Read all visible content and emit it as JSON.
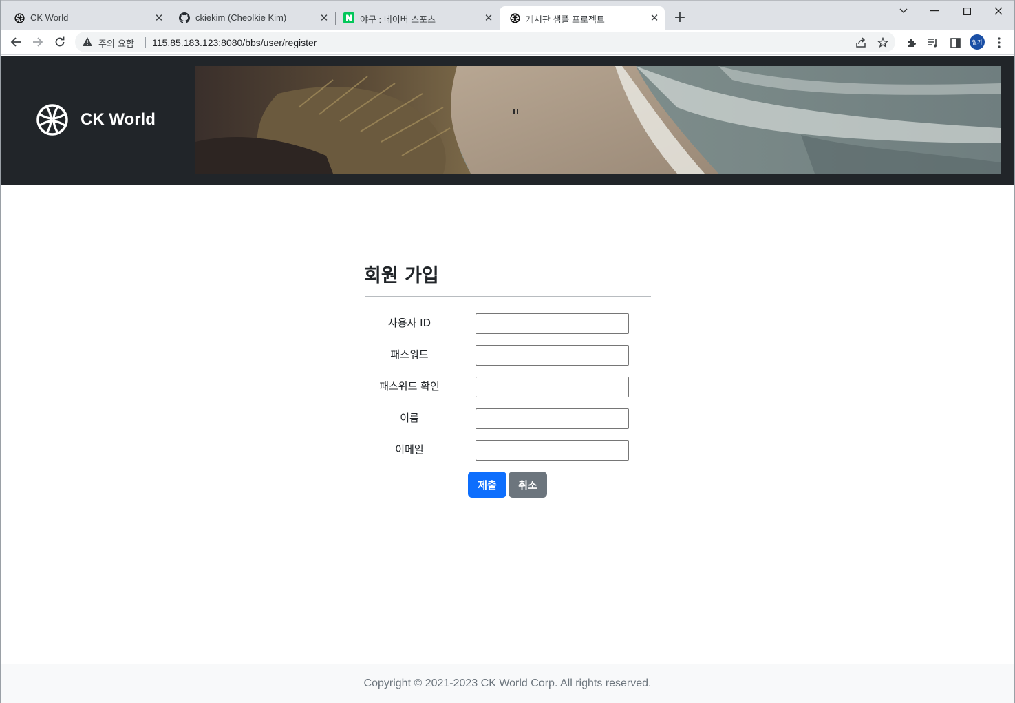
{
  "browser": {
    "tabs": [
      {
        "title": "CK World",
        "favicon": "ckworld-globe-icon"
      },
      {
        "title": "ckiekim (Cheolkie Kim)",
        "favicon": "github-icon"
      },
      {
        "title": "야구 : 네이버 스포츠",
        "favicon": "naver-icon"
      },
      {
        "title": "게시판 샘플 프로젝트",
        "favicon": "ckworld-globe-icon",
        "active": true
      }
    ],
    "security_label": "주의 요함",
    "url": "115.85.183.123:8080/bbs/user/register",
    "profile_initials": "철기"
  },
  "header": {
    "brand_name": "CK World",
    "brand_icon": "globe-icon",
    "banner": "coastal-dune-beach-photo"
  },
  "form": {
    "title": "회원 가입",
    "fields": [
      {
        "label": "사용자 ID",
        "value": ""
      },
      {
        "label": "패스워드",
        "value": ""
      },
      {
        "label": "패스워드 확인",
        "value": ""
      },
      {
        "label": "이름",
        "value": ""
      },
      {
        "label": "이메일",
        "value": ""
      }
    ],
    "submit_label": "제출",
    "cancel_label": "취소"
  },
  "footer": {
    "copyright": "Copyright © 2021-2023 CK World Corp. All rights reserved."
  },
  "colors": {
    "header_bg": "#212529",
    "primary": "#0d6efd",
    "secondary": "#6c757d",
    "footer_bg": "#f8f9fa"
  }
}
